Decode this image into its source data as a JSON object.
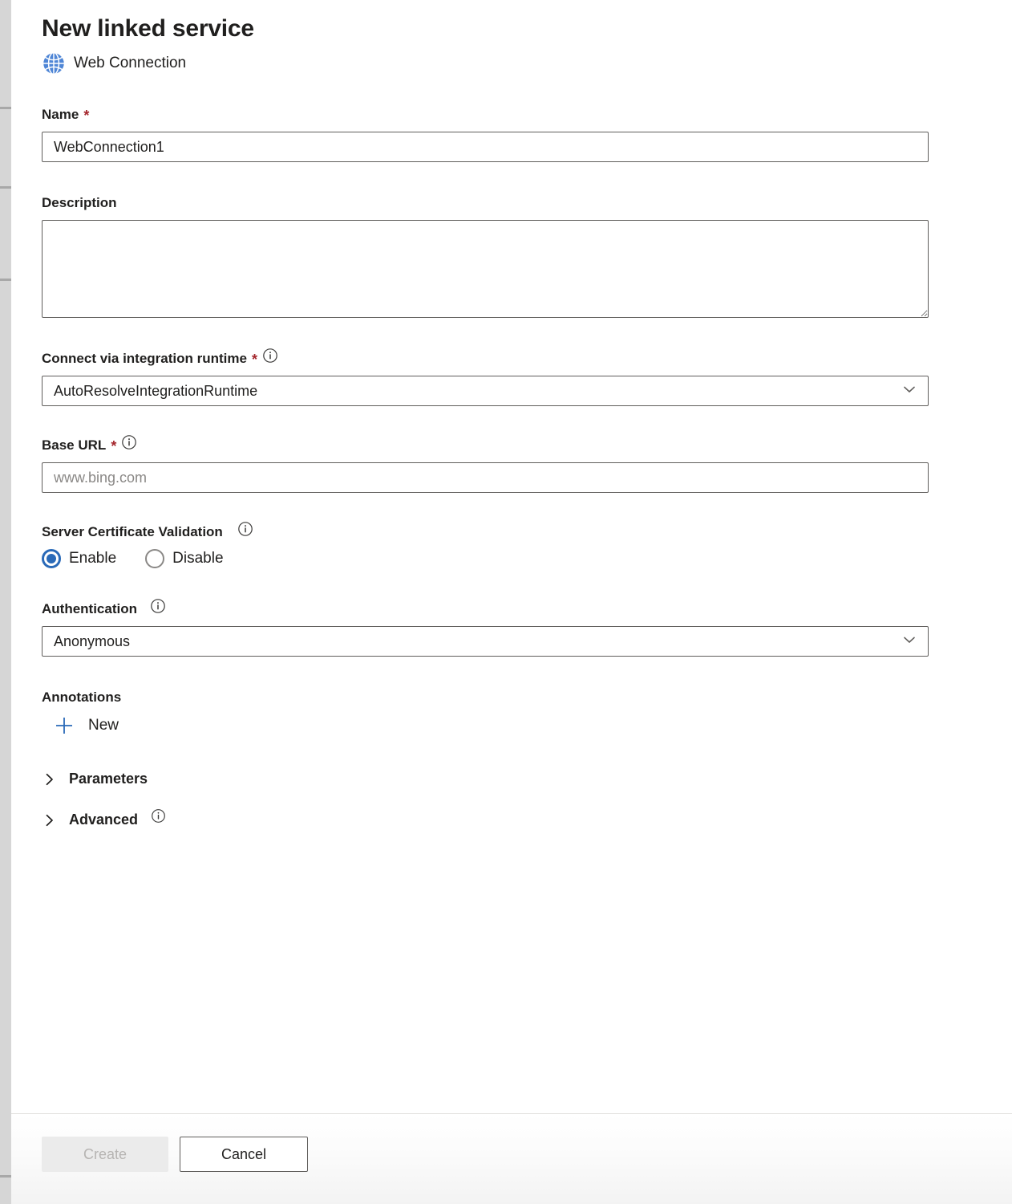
{
  "header": {
    "title": "New linked service",
    "service_type": "Web Connection",
    "service_icon": "globe-icon"
  },
  "colors": {
    "accent_blue": "#2a6ab8",
    "required_red": "#a4262c",
    "border_gray": "#605e5c",
    "placeholder_gray": "#8a8886",
    "disabled_text": "#b6b4b2",
    "disabled_bg": "#ebebeb"
  },
  "fields": {
    "name": {
      "label": "Name",
      "required_marker": "*",
      "value": "WebConnection1",
      "placeholder": ""
    },
    "description": {
      "label": "Description",
      "value": "",
      "placeholder": ""
    },
    "integration_runtime": {
      "label": "Connect via integration runtime",
      "required_marker": "*",
      "info_icon": "info-icon",
      "value": "AutoResolveIntegrationRuntime",
      "chevron": "chevron-down-icon",
      "options": [
        "AutoResolveIntegrationRuntime"
      ]
    },
    "base_url": {
      "label": "Base URL",
      "required_marker": "*",
      "info_icon": "info-icon",
      "value": "",
      "placeholder": "www.bing.com"
    },
    "server_certificate_validation": {
      "label": "Server Certificate Validation",
      "info_icon": "info-icon",
      "selected": "Enable",
      "options": [
        {
          "label": "Enable",
          "selected": true
        },
        {
          "label": "Disable",
          "selected": false
        }
      ]
    },
    "authentication": {
      "label": "Authentication",
      "info_icon": "info-icon",
      "value": "Anonymous",
      "chevron": "chevron-down-icon",
      "options": [
        "Anonymous"
      ]
    },
    "annotations": {
      "label": "Annotations",
      "new_label": "New",
      "new_icon": "plus-icon"
    }
  },
  "collapsibles": [
    {
      "label": "Parameters",
      "icon": "chevron-right-icon",
      "expanded": false,
      "info_icon": null
    },
    {
      "label": "Advanced",
      "icon": "chevron-right-icon",
      "expanded": false,
      "info_icon": "info-icon"
    }
  ],
  "footer": {
    "create_label": "Create",
    "create_disabled": true,
    "cancel_label": "Cancel"
  }
}
